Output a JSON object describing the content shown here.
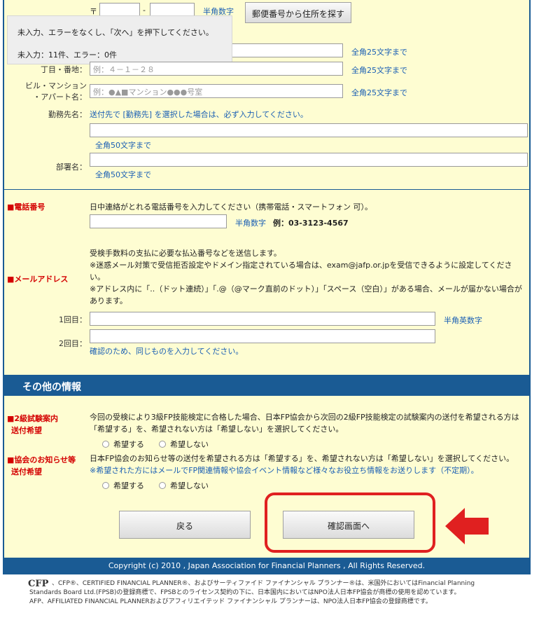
{
  "postal": {
    "mark": "〒",
    "dash": "-",
    "hint": "半角数字",
    "search_button": "郵便番号から住所を探す"
  },
  "tooltip": {
    "line1": "未入力、エラーをなくし、「次へ」を押下してください。",
    "line2": "未入力：11件、エラー：0件"
  },
  "address": {
    "city_hint": "全角25文字まで",
    "street_label": "丁目・番地：",
    "street_placeholder": "例：４－１－２８",
    "street_hint": "全角25文字まで",
    "building_label_1": "ビル・マンション",
    "building_label_2": "・アパート名：",
    "building_placeholder": "例：●▲■マンション●●●号室",
    "building_hint": "全角25文字まで"
  },
  "workplace": {
    "label": "勤務先名：",
    "note": "送付先で [勤務先] を選択した場合は、必ず入力してください。",
    "hint": "全角50文字まで"
  },
  "department": {
    "label": "部署名：",
    "hint": "全角50文字まで"
  },
  "phone": {
    "heading": "■電話番号",
    "note": "日中連絡がとれる電話番号を入力してください（携帯電話・スマートフォン 可）。",
    "hint": "半角数字",
    "example": "例：03-3123-4567"
  },
  "email": {
    "heading": "■メールアドレス",
    "note1": "受検手数料の支払に必要な払込番号などを送信します。",
    "note2": "※迷惑メール対策で受信拒否設定やドメイン指定されている場合は、exam@jafp.or.jpを受信できるように設定してください。",
    "note3": "※アドレス内に「..（ドット連続）」「.@（@マーク直前のドット）」「スペース（空白）」がある場合、メールが届かない場合があります。",
    "first_label": "1回目：",
    "first_hint": "半角英数字",
    "second_label": "2回目：",
    "second_hint": "確認のため、同じものを入力してください。"
  },
  "other": {
    "section_title": "その他の情報",
    "exam_info_heading_1": "■2級試験案内",
    "exam_info_heading_2": "送付希望",
    "exam_info_text": "今回の受検により3級FP技能検定に合格した場合、日本FP協会から次回の2級FP技能検定の試験案内の送付を希望される方は「希望する」を、希望されない方は「希望しない」を選択してください。",
    "news_heading_1": "■協会のお知らせ等",
    "news_heading_2": "送付希望",
    "news_text": "日本FP協会のお知らせ等の送付を希望される方は「希望する」を、希望されない方は「希望しない」を選択してください。",
    "news_note": "※希望された方にはメールでFP関連情報や協会イベント情報など様々なお役立ち情報をお送りします（不定期）。",
    "option_yes": "希望する",
    "option_no": "希望しない"
  },
  "buttons": {
    "back": "戻る",
    "confirm": "確認画面へ"
  },
  "footer": {
    "copyright": "Copyright (c) 2010 , Japan Association for Financial Planners , All Rights Reserved.",
    "legal_1": "、CFP®、CERTIFIED FINANCIAL PLANNER®、およびサーティファイド ファイナンシャル プランナー®は、米国外においてはFinancial Planning",
    "legal_2": "Standards Board Ltd.(FPSB)の登録商標で、FPSBとのライセンス契約の下に、日本国内においてはNPO法人日本FP協会が商標の使用を認めています。",
    "legal_3": "AFP、AFFILIATED FINANCIAL PLANNERおよびアフィリエイテッド ファイナンシャル プランナーは、NPO法人日本FP協会の登録商標です。"
  },
  "colors": {
    "panel_bg": "#fefdd2",
    "header_blue": "#1a5b94",
    "hint_blue": "#1a5fb4",
    "heading_red": "#d40000",
    "highlight_red": "#e02020"
  }
}
